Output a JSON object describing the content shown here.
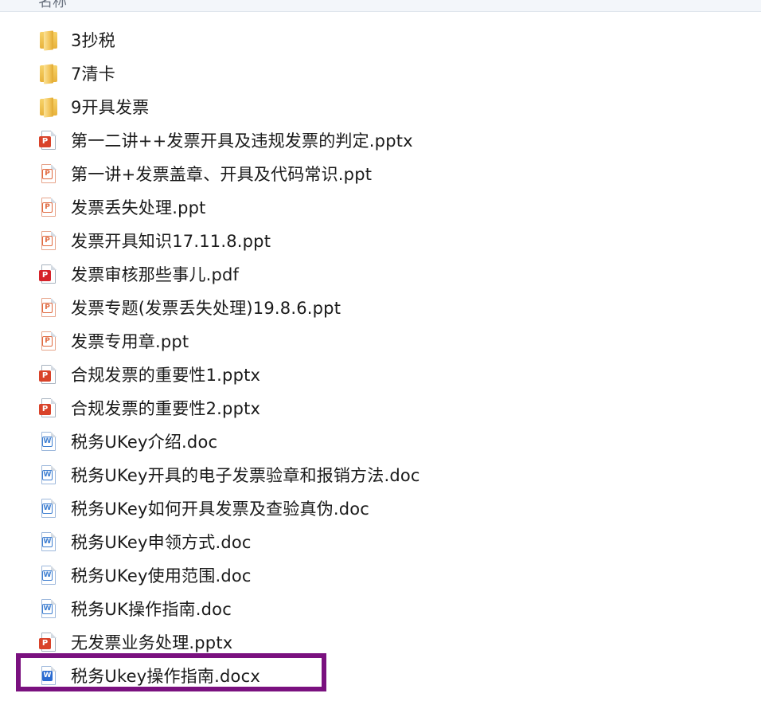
{
  "header": {
    "label": "名称"
  },
  "files": [
    {
      "name": "3抄税",
      "icon": "folder-icon",
      "type": "folder"
    },
    {
      "name": "7清卡",
      "icon": "folder-icon",
      "type": "folder"
    },
    {
      "name": "9开具发票",
      "icon": "folder-icon",
      "type": "folder"
    },
    {
      "name": "第一二讲++发票开具及违规发票的判定.pptx",
      "icon": "pptx-icon",
      "type": "pptx"
    },
    {
      "name": "第一讲+发票盖章、开具及代码常识.ppt",
      "icon": "ppt-icon",
      "type": "ppt"
    },
    {
      "name": "发票丢失处理.ppt",
      "icon": "ppt-icon",
      "type": "ppt"
    },
    {
      "name": "发票开具知识17.11.8.ppt",
      "icon": "ppt-icon",
      "type": "ppt"
    },
    {
      "name": "发票审核那些事儿.pdf",
      "icon": "pdf-icon",
      "type": "pdf"
    },
    {
      "name": "发票专题(发票丢失处理)19.8.6.ppt",
      "icon": "ppt-icon",
      "type": "ppt"
    },
    {
      "name": "发票专用章.ppt",
      "icon": "ppt-icon",
      "type": "ppt"
    },
    {
      "name": "合规发票的重要性1.pptx",
      "icon": "pptx-icon",
      "type": "pptx"
    },
    {
      "name": "合规发票的重要性2.pptx",
      "icon": "pptx-icon",
      "type": "pptx"
    },
    {
      "name": "税务UKey介绍.doc",
      "icon": "doc-icon",
      "type": "doc"
    },
    {
      "name": "税务UKey开具的电子发票验章和报销方法.doc",
      "icon": "doc-icon",
      "type": "doc"
    },
    {
      "name": "税务UKey如何开具发票及查验真伪.doc",
      "icon": "doc-icon",
      "type": "doc"
    },
    {
      "name": "税务UKey申领方式.doc",
      "icon": "doc-icon",
      "type": "doc"
    },
    {
      "name": "税务UKey使用范围.doc",
      "icon": "doc-icon",
      "type": "doc"
    },
    {
      "name": "税务UK操作指南.doc",
      "icon": "doc-icon",
      "type": "doc"
    },
    {
      "name": "无发票业务处理.pptx",
      "icon": "pptx-icon",
      "type": "pptx"
    },
    {
      "name": "税务Ukey操作指南.docx",
      "icon": "docx-icon",
      "type": "docx",
      "highlighted": true
    }
  ],
  "colors": {
    "pptx": "#d9432a",
    "ppt": "#e06a40",
    "pdf": "#d6232a",
    "doc": "#3f7fd1",
    "docx": "#2a6bd1",
    "highlight": "#7a117f"
  }
}
